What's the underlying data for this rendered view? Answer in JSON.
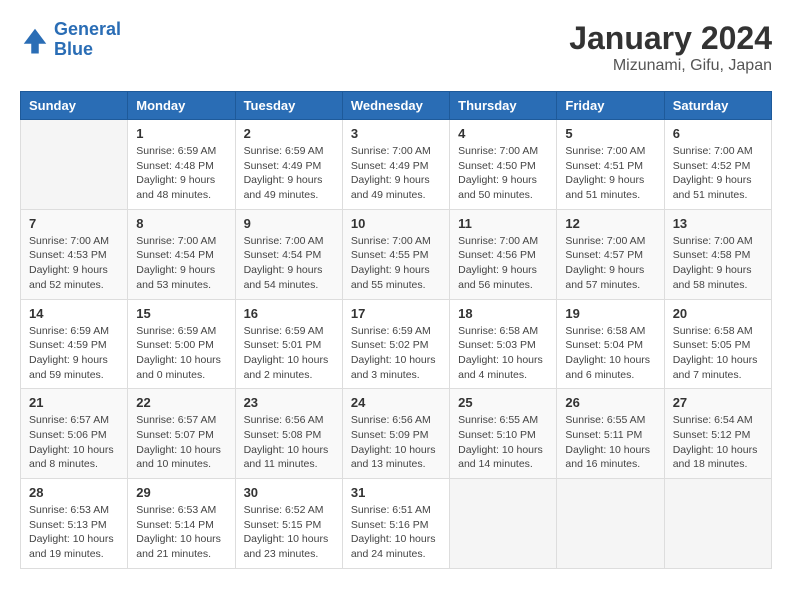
{
  "logo": {
    "text_general": "General",
    "text_blue": "Blue"
  },
  "title": "January 2024",
  "subtitle": "Mizunami, Gifu, Japan",
  "days_header": [
    "Sunday",
    "Monday",
    "Tuesday",
    "Wednesday",
    "Thursday",
    "Friday",
    "Saturday"
  ],
  "weeks": [
    [
      {
        "day": "",
        "info": ""
      },
      {
        "day": "1",
        "info": "Sunrise: 6:59 AM\nSunset: 4:48 PM\nDaylight: 9 hours\nand 48 minutes."
      },
      {
        "day": "2",
        "info": "Sunrise: 6:59 AM\nSunset: 4:49 PM\nDaylight: 9 hours\nand 49 minutes."
      },
      {
        "day": "3",
        "info": "Sunrise: 7:00 AM\nSunset: 4:49 PM\nDaylight: 9 hours\nand 49 minutes."
      },
      {
        "day": "4",
        "info": "Sunrise: 7:00 AM\nSunset: 4:50 PM\nDaylight: 9 hours\nand 50 minutes."
      },
      {
        "day": "5",
        "info": "Sunrise: 7:00 AM\nSunset: 4:51 PM\nDaylight: 9 hours\nand 51 minutes."
      },
      {
        "day": "6",
        "info": "Sunrise: 7:00 AM\nSunset: 4:52 PM\nDaylight: 9 hours\nand 51 minutes."
      }
    ],
    [
      {
        "day": "7",
        "info": "Sunrise: 7:00 AM\nSunset: 4:53 PM\nDaylight: 9 hours\nand 52 minutes."
      },
      {
        "day": "8",
        "info": "Sunrise: 7:00 AM\nSunset: 4:54 PM\nDaylight: 9 hours\nand 53 minutes."
      },
      {
        "day": "9",
        "info": "Sunrise: 7:00 AM\nSunset: 4:54 PM\nDaylight: 9 hours\nand 54 minutes."
      },
      {
        "day": "10",
        "info": "Sunrise: 7:00 AM\nSunset: 4:55 PM\nDaylight: 9 hours\nand 55 minutes."
      },
      {
        "day": "11",
        "info": "Sunrise: 7:00 AM\nSunset: 4:56 PM\nDaylight: 9 hours\nand 56 minutes."
      },
      {
        "day": "12",
        "info": "Sunrise: 7:00 AM\nSunset: 4:57 PM\nDaylight: 9 hours\nand 57 minutes."
      },
      {
        "day": "13",
        "info": "Sunrise: 7:00 AM\nSunset: 4:58 PM\nDaylight: 9 hours\nand 58 minutes."
      }
    ],
    [
      {
        "day": "14",
        "info": "Sunrise: 6:59 AM\nSunset: 4:59 PM\nDaylight: 9 hours\nand 59 minutes."
      },
      {
        "day": "15",
        "info": "Sunrise: 6:59 AM\nSunset: 5:00 PM\nDaylight: 10 hours\nand 0 minutes."
      },
      {
        "day": "16",
        "info": "Sunrise: 6:59 AM\nSunset: 5:01 PM\nDaylight: 10 hours\nand 2 minutes."
      },
      {
        "day": "17",
        "info": "Sunrise: 6:59 AM\nSunset: 5:02 PM\nDaylight: 10 hours\nand 3 minutes."
      },
      {
        "day": "18",
        "info": "Sunrise: 6:58 AM\nSunset: 5:03 PM\nDaylight: 10 hours\nand 4 minutes."
      },
      {
        "day": "19",
        "info": "Sunrise: 6:58 AM\nSunset: 5:04 PM\nDaylight: 10 hours\nand 6 minutes."
      },
      {
        "day": "20",
        "info": "Sunrise: 6:58 AM\nSunset: 5:05 PM\nDaylight: 10 hours\nand 7 minutes."
      }
    ],
    [
      {
        "day": "21",
        "info": "Sunrise: 6:57 AM\nSunset: 5:06 PM\nDaylight: 10 hours\nand 8 minutes."
      },
      {
        "day": "22",
        "info": "Sunrise: 6:57 AM\nSunset: 5:07 PM\nDaylight: 10 hours\nand 10 minutes."
      },
      {
        "day": "23",
        "info": "Sunrise: 6:56 AM\nSunset: 5:08 PM\nDaylight: 10 hours\nand 11 minutes."
      },
      {
        "day": "24",
        "info": "Sunrise: 6:56 AM\nSunset: 5:09 PM\nDaylight: 10 hours\nand 13 minutes."
      },
      {
        "day": "25",
        "info": "Sunrise: 6:55 AM\nSunset: 5:10 PM\nDaylight: 10 hours\nand 14 minutes."
      },
      {
        "day": "26",
        "info": "Sunrise: 6:55 AM\nSunset: 5:11 PM\nDaylight: 10 hours\nand 16 minutes."
      },
      {
        "day": "27",
        "info": "Sunrise: 6:54 AM\nSunset: 5:12 PM\nDaylight: 10 hours\nand 18 minutes."
      }
    ],
    [
      {
        "day": "28",
        "info": "Sunrise: 6:53 AM\nSunset: 5:13 PM\nDaylight: 10 hours\nand 19 minutes."
      },
      {
        "day": "29",
        "info": "Sunrise: 6:53 AM\nSunset: 5:14 PM\nDaylight: 10 hours\nand 21 minutes."
      },
      {
        "day": "30",
        "info": "Sunrise: 6:52 AM\nSunset: 5:15 PM\nDaylight: 10 hours\nand 23 minutes."
      },
      {
        "day": "31",
        "info": "Sunrise: 6:51 AM\nSunset: 5:16 PM\nDaylight: 10 hours\nand 24 minutes."
      },
      {
        "day": "",
        "info": ""
      },
      {
        "day": "",
        "info": ""
      },
      {
        "day": "",
        "info": ""
      }
    ]
  ]
}
